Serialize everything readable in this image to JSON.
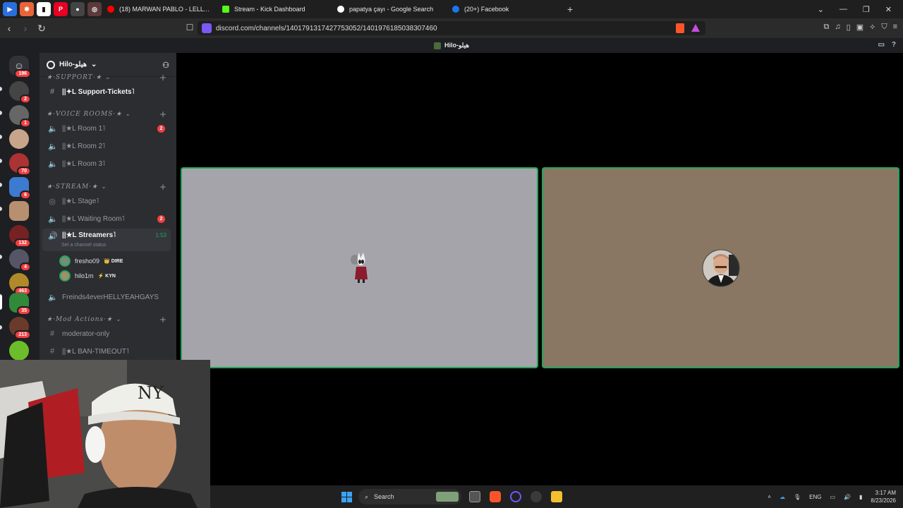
{
  "browser": {
    "tabs": [
      {
        "title": "(18) MARWAN PABLO - LELLY YAH |L",
        "fav": "#ff0000",
        "active": false
      },
      {
        "title": "Stream - Kick Dashboard",
        "fav": "#53fc18",
        "active": true
      },
      {
        "title": "papatya çayı - Google Search",
        "fav": "#ffffff",
        "active": false
      },
      {
        "title": "(20+) Facebook",
        "fav": "#1877f2",
        "active": false
      }
    ],
    "url": "discord.com/channels/1401791317427753052/1401976185038307460"
  },
  "window_title": "Hilo-هيلو",
  "guild": {
    "name": "Hilo-هيلو"
  },
  "servers": [
    {
      "badge": "196",
      "color": "#5865f2"
    },
    {
      "badge": "2",
      "color": "#444"
    },
    {
      "badge": "1",
      "color": "#666"
    },
    {
      "badge": "",
      "color": "#c8a58a"
    },
    {
      "badge": "70",
      "color": "#a33"
    },
    {
      "badge": "6",
      "color": "#3c7bd0"
    },
    {
      "badge": "",
      "color": "#b89070"
    },
    {
      "badge": "132",
      "color": "#722"
    },
    {
      "badge": "4",
      "color": "#556"
    },
    {
      "badge": "463",
      "color": "#b08a2a"
    },
    {
      "badge": "35",
      "color": "#2f8a3a"
    },
    {
      "badge": "213",
      "color": "#6a3a2a"
    },
    {
      "badge": "",
      "color": "#6cbd2a"
    }
  ],
  "categories": {
    "support": "★·SUPPORT·★",
    "voice": "★·VOICE ROOMS·★",
    "stream": "★·STREAM·★",
    "mod": "★·Mod Actions·★"
  },
  "channels": {
    "support_tickets": "||✦L Support-Tickets˥",
    "room1": "||★L Room 1˥",
    "room1_count": "2",
    "room2": "||★L Room 2˥",
    "room3": "||★L Room 3˥",
    "stage": "||★L Stage˥",
    "waiting": "||★L Waiting Room˥",
    "waiting_count": "2",
    "streamers": "||★L Streamers˥",
    "streamers_timer": "1:53",
    "streamers_status": "Set a channel status",
    "freinds": "Freinds4everHELLYEAHGAYS",
    "moderator": "moderator-only",
    "ban": "||★L BAN-TIMEOUT˥"
  },
  "members": [
    {
      "name": "fresho09",
      "tag": "👑 DIRE"
    },
    {
      "name": "hilo1m",
      "tag": "⚡ KYN"
    }
  ],
  "taskbar": {
    "search": "Search",
    "lang": "ENG",
    "time": "3:17 AM",
    "date": "8/23/2026"
  }
}
